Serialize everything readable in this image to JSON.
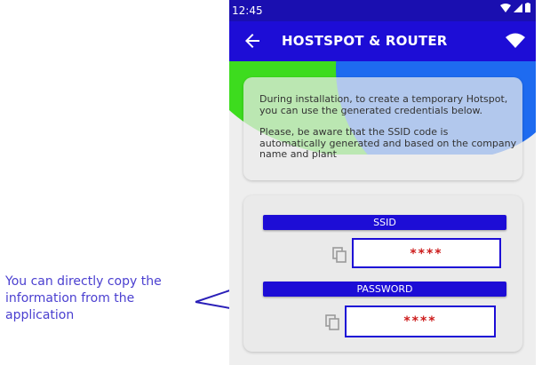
{
  "annotation": {
    "text": "You can directly copy the information from the application"
  },
  "statusbar": {
    "time": "12:45"
  },
  "appbar": {
    "title": "HOSTSPOT & ROUTER"
  },
  "info": {
    "paragraph1": "During installation, to create a temporary Hotspot, you can use the generated credentials below.",
    "paragraph2": "Please, be aware that the SSID code is automatically generated and based on the company name and plant"
  },
  "credentials": {
    "ssid_label": "SSID",
    "ssid_value": "****",
    "password_label": "PASSWORD",
    "password_value": "****"
  },
  "colors": {
    "primary": "#1d0dd6",
    "accent_green": "#3ddc1e",
    "accent_blue": "#1e6bf0",
    "masked_text": "#cc1a1a",
    "annotation": "#4a3fd0"
  },
  "icons": [
    "back-arrow-icon",
    "wifi-icon",
    "signal-icon",
    "battery-icon",
    "copy-icon"
  ]
}
